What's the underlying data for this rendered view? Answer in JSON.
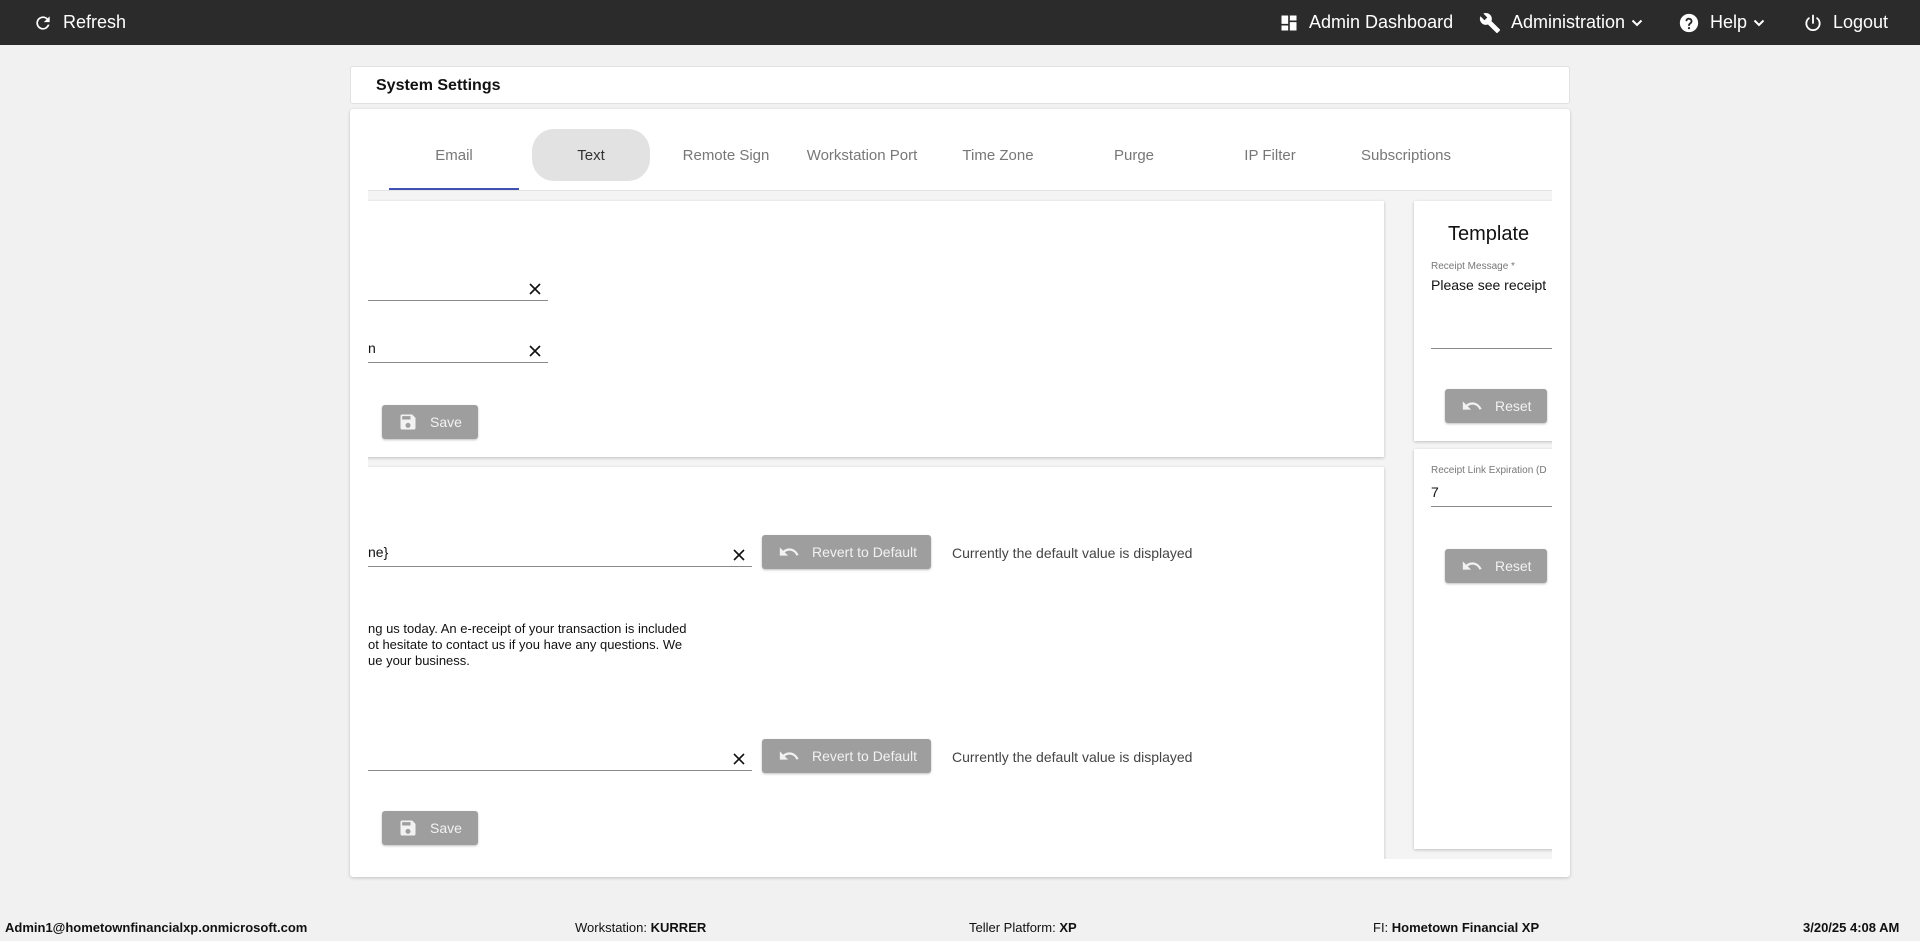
{
  "topbar": {
    "refresh_label": "Refresh",
    "admin_dashboard_label": "Admin Dashboard",
    "administration_label": "Administration",
    "help_label": "Help",
    "logout_label": "Logout"
  },
  "page": {
    "title": "System Settings"
  },
  "tabs": [
    "Email",
    "Text",
    "Remote Sign",
    "Workstation Port",
    "Time Zone",
    "Purge",
    "IP Filter",
    "Subscriptions"
  ],
  "selected_tab": "Email",
  "hovered_tab": "Text",
  "left_top_panel": {
    "field1_value": "",
    "field2_value": "n",
    "save_label": "Save"
  },
  "left_bottom_panel": {
    "subject_value": "ne}",
    "revert_label": "Revert to Default",
    "default_note": "Currently the default value is displayed",
    "body_lines": [
      "ng us today. An e-receipt of your transaction is included",
      "ot hesitate to contact us if you have any questions. We",
      "ue your business."
    ],
    "field3_value": "",
    "revert2_label": "Revert to Default",
    "default_note2": "Currently the default value is displayed",
    "save_label": "Save"
  },
  "right_top_panel": {
    "title": "Template",
    "receipt_message_label": "Receipt Message *",
    "receipt_message_value": "Please see receipt",
    "reset_label": "Reset"
  },
  "right_bottom_panel": {
    "expiration_label": "Receipt Link Expiration (D",
    "expiration_value": "7",
    "reset_label": "Reset"
  },
  "statusbar": {
    "user": "Admin1@hometownfinancialxp.onmicrosoft.com",
    "workstation_label": "Workstation:",
    "workstation_value": "KURRER",
    "platform_label": "Teller Platform:",
    "platform_value": "XP",
    "fi_label": "FI:",
    "fi_value": "Hometown Financial XP",
    "datetime": "3/20/25 4:08 AM"
  },
  "colors": {
    "topbar_bg": "#2b2b2b",
    "tab_ink": "#3f51b5",
    "button_disabled": "#9e9e9e",
    "page_bg": "#f1f1f1"
  }
}
